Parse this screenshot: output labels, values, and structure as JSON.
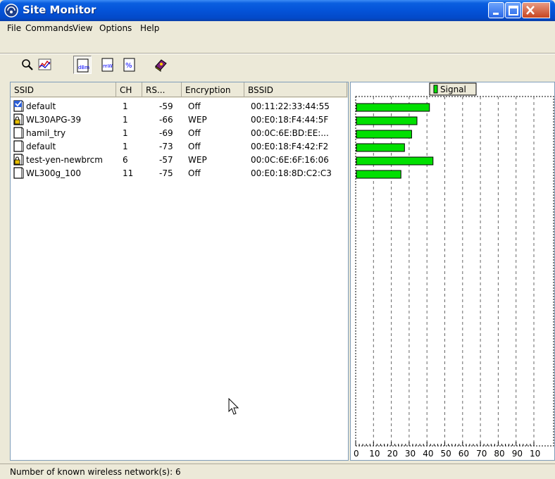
{
  "window": {
    "title": "Site Monitor"
  },
  "menu": [
    "File",
    "Commands",
    "View",
    "Options",
    "Help"
  ],
  "toolbar": [
    {
      "name": "search-icon",
      "pressed": false
    },
    {
      "name": "graph-icon",
      "pressed": false
    },
    {
      "name": "dbm-icon",
      "pressed": true
    },
    {
      "name": "mw-icon",
      "pressed": false
    },
    {
      "name": "percent-icon",
      "pressed": false
    },
    {
      "name": "help-book-icon",
      "pressed": false
    }
  ],
  "table": {
    "columns": [
      "SSID",
      "CH",
      "RS...",
      "Encryption",
      "BSSID"
    ],
    "rows": [
      {
        "ssid": "default",
        "ch": "1",
        "rssi": "-59",
        "encryption": "Off",
        "bssid": "00:11:22:33:44:55",
        "icon": "connected-icon"
      },
      {
        "ssid": "WL30APG-39",
        "ch": "1",
        "rssi": "-66",
        "encryption": "WEP",
        "bssid": "00:E0:18:F4:44:5F",
        "icon": "locked-network-icon"
      },
      {
        "ssid": "hamil_try",
        "ch": "1",
        "rssi": "-69",
        "encryption": "Off",
        "bssid": "00:0C:6E:BD:EE:...",
        "icon": "network-icon"
      },
      {
        "ssid": "default",
        "ch": "1",
        "rssi": "-73",
        "encryption": "Off",
        "bssid": "00:E0:18:F4:42:F2",
        "icon": "network-icon"
      },
      {
        "ssid": "test-yen-newbrcm",
        "ch": "6",
        "rssi": "-57",
        "encryption": "WEP",
        "bssid": "00:0C:6E:6F:16:06",
        "icon": "locked-network-icon"
      },
      {
        "ssid": "WL300g_100",
        "ch": "11",
        "rssi": "-75",
        "encryption": "Off",
        "bssid": "00:E0:18:8D:C2:C3",
        "icon": "network-icon"
      }
    ]
  },
  "chart_data": {
    "type": "bar",
    "orientation": "horizontal",
    "legend": "Signal",
    "legend_position": "top-center",
    "bar_color": "#00e000",
    "x_ticks": [
      "0",
      "10",
      "20",
      "30",
      "40",
      "50",
      "60",
      "70",
      "80",
      "90",
      "10"
    ],
    "xlim": [
      0,
      100
    ],
    "grid": true,
    "values": [
      41,
      34,
      31,
      27,
      43,
      25
    ]
  },
  "status": {
    "text": "Number of known wireless network(s): 6"
  }
}
